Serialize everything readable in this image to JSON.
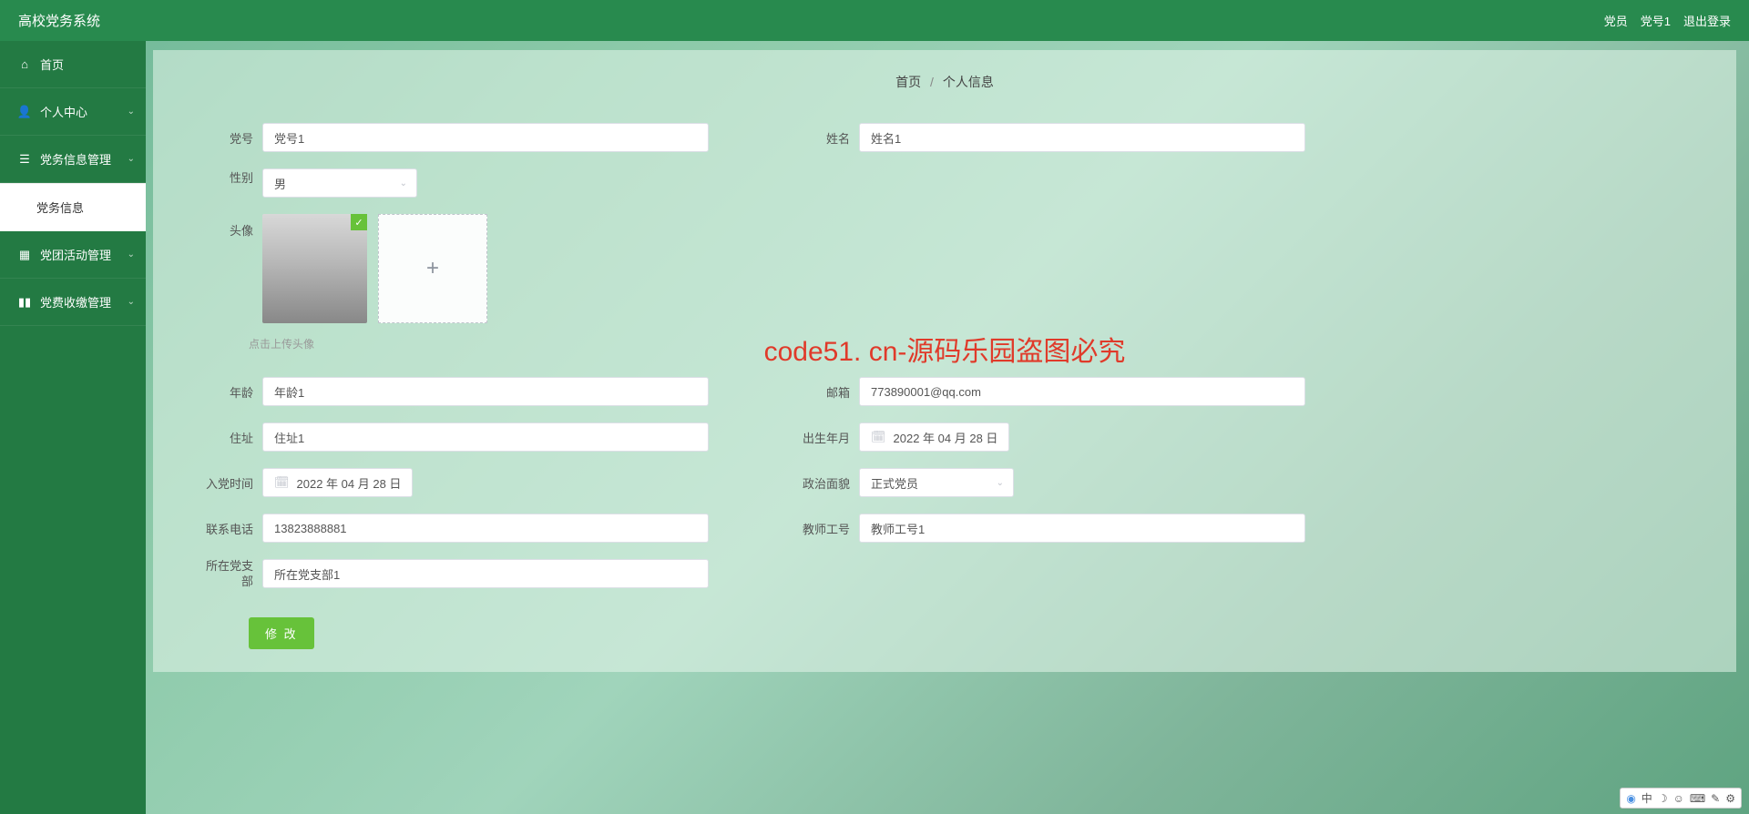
{
  "header": {
    "title": "高校党务系统",
    "user_role": "党员",
    "user_name": "党号1",
    "logout": "退出登录"
  },
  "sidebar": {
    "items": [
      {
        "label": "首页",
        "icon": "home"
      },
      {
        "label": "个人中心",
        "icon": "user",
        "expand": true
      },
      {
        "label": "党务信息管理",
        "icon": "list",
        "expand": true
      },
      {
        "label": "党务信息",
        "sub": true
      },
      {
        "label": "党团活动管理",
        "icon": "grid",
        "expand": true
      },
      {
        "label": "党费收缴管理",
        "icon": "bars",
        "expand": true
      }
    ]
  },
  "breadcrumb": {
    "root": "首页",
    "current": "个人信息"
  },
  "form": {
    "partyNumber": {
      "label": "党号",
      "value": "党号1"
    },
    "name": {
      "label": "姓名",
      "value": "姓名1"
    },
    "gender": {
      "label": "性别",
      "value": "男"
    },
    "avatar": {
      "label": "头像",
      "hint": "点击上传头像"
    },
    "age": {
      "label": "年龄",
      "value": "年龄1"
    },
    "email": {
      "label": "邮箱",
      "value": "773890001@qq.com"
    },
    "address": {
      "label": "住址",
      "value": "住址1"
    },
    "birth": {
      "label": "出生年月",
      "value": "2022 年 04 月 28 日"
    },
    "joinDate": {
      "label": "入党时间",
      "value": "2022 年 04 月 28 日"
    },
    "politics": {
      "label": "政治面貌",
      "value": "正式党员"
    },
    "phone": {
      "label": "联系电话",
      "value": "13823888881"
    },
    "teacherId": {
      "label": "教师工号",
      "value": "教师工号1"
    },
    "branch": {
      "label": "所在党支部",
      "value": "所在党支部1"
    }
  },
  "button": {
    "submit": "修 改"
  },
  "watermark": "code51. cn-源码乐园盗图必究",
  "ime": {
    "label": "中"
  }
}
